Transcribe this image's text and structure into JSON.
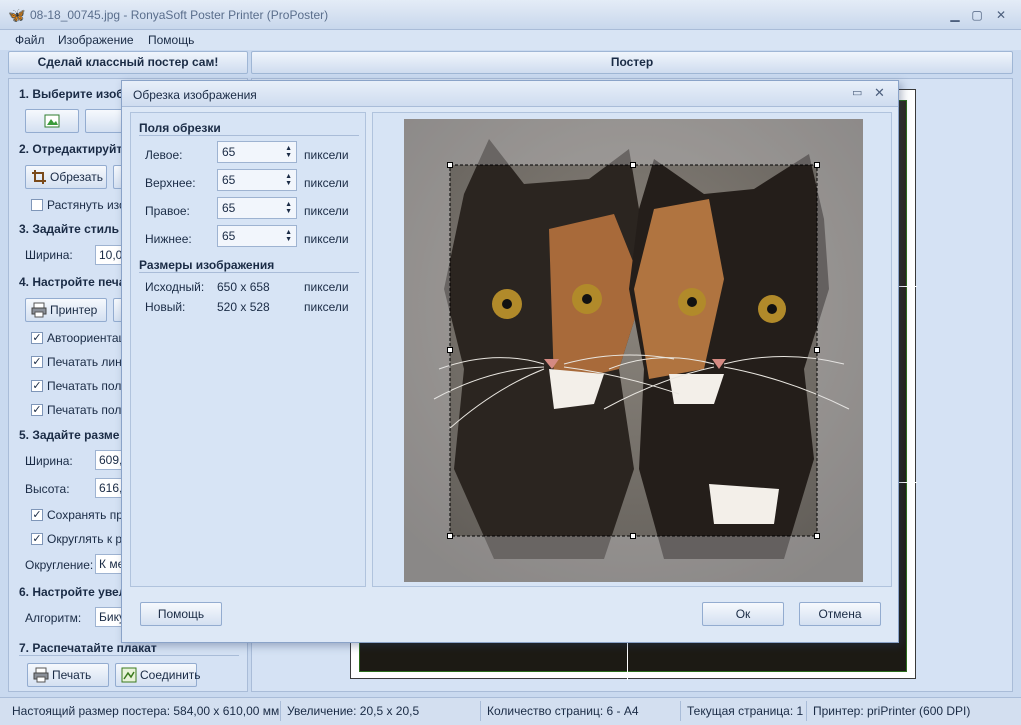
{
  "window": {
    "title": "08-18_00745.jpg - RonyaSoft Poster Printer (ProPoster)"
  },
  "menu": [
    "Файл",
    "Изображение",
    "Помощь"
  ],
  "tabs": [
    "Сделай классный постер сам!",
    "Постер"
  ],
  "left": {
    "s1": "1. Выберите изоб",
    "s2": "2. Отредактируйт",
    "crop_btn": "Обрезать",
    "stretch": "Растянуть изо",
    "s3": "3. Задайте стиль",
    "width_lbl": "Ширина:",
    "width_val": "10,0",
    "s4": "4. Настройте печа",
    "printer_btn": "Принтер",
    "cb1": "Автоориентац",
    "cb2": "Печатать лини",
    "cb3": "Печатать поля",
    "cb4": "Печатать поля",
    "s5": "5. Задайте разме",
    "w_lbl": "Ширина:",
    "w_val": "609,",
    "h_lbl": "Высота:",
    "h_val": "616,",
    "cb5": "Сохранять про",
    "cb6": "Округлять к р",
    "round_lbl": "Округление:",
    "round_val": "К ме",
    "s6": "6. Настройте увел",
    "algo_lbl": "Алгоритм:",
    "algo_val": "Бику",
    "s7": "7. Распечатайте плакат",
    "print_btn": "Печать",
    "join_btn": "Соединить"
  },
  "status": {
    "size": "Настоящий размер постера: 584,00 x 610,00 мм",
    "zoom": "Увеличение: 20,5 x 20,5",
    "pages": "Количество страниц: 6 - A4",
    "current": "Текущая страница: 1",
    "printer": "Принтер: priPrinter (600 DPI)"
  },
  "dialog": {
    "title": "Обрезка изображения",
    "margins_group": "Поля обрезки",
    "left_lbl": "Левое:",
    "left_val": "65",
    "top_lbl": "Верхнее:",
    "top_val": "65",
    "right_lbl": "Правое:",
    "right_val": "65",
    "bottom_lbl": "Нижнее:",
    "bottom_val": "65",
    "unit": "пиксели",
    "sizes_group": "Размеры изображения",
    "orig_lbl": "Исходный:",
    "orig_val": "650 x 658",
    "new_lbl": "Новый:",
    "new_val": "520 x 528",
    "help_btn": "Помощь",
    "ok_btn": "Ок",
    "cancel_btn": "Отмена"
  }
}
